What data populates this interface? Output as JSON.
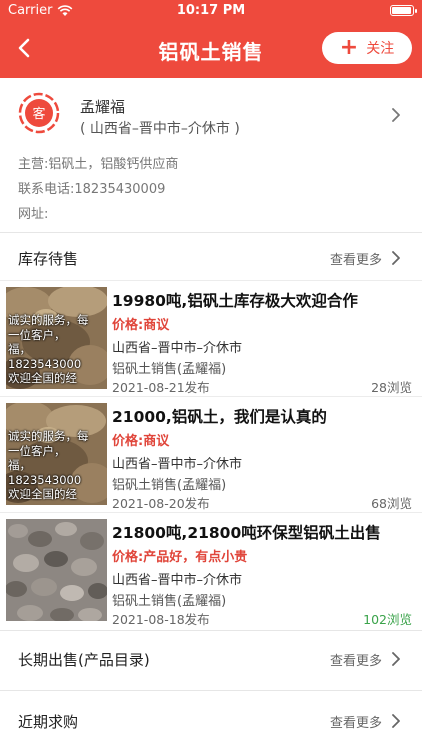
{
  "status_bar": {
    "carrier": "Carrier",
    "time": "10:17 PM",
    "battery_level": 0.95
  },
  "header": {
    "title": "铝矾土销售",
    "follow_label": "关注"
  },
  "profile": {
    "avatar_text": "客",
    "name": "孟耀福",
    "region": "( 山西省–晋中市–介休市 )",
    "business": "主营:铝矾土，铝酸钙供应商",
    "phone": "联系电话:18235430009",
    "website": "网址:"
  },
  "sections": {
    "inventory": {
      "title": "库存待售",
      "more": "查看更多"
    },
    "long_term": {
      "title": "长期出售(产品目录)",
      "more": "查看更多"
    },
    "recent": {
      "title": "近期求购",
      "more": "查看更多"
    }
  },
  "thumb_overlay_lines": [
    "诚实的服务，每",
    "一位客户，",
    "福，",
    "1823543000",
    "欢迎全国的经"
  ],
  "items": [
    {
      "title": "19980吨,铝矾土库存极大欢迎合作",
      "price": "价格:商议",
      "location": "山西省–晋中市–介休市",
      "seller": "铝矾土销售(孟耀福)",
      "date": "2021-08-21发布",
      "views": "28浏览"
    },
    {
      "title": "21000,铝矾土，我们是认真的",
      "price": "价格:商议",
      "location": "山西省–晋中市–介休市",
      "seller": "铝矾土销售(孟耀福)",
      "date": "2021-08-20发布",
      "views": "68浏览"
    },
    {
      "title": "21800吨,21800吨环保型铝矾土出售",
      "price": "价格:产品好，有点小贵",
      "location": "山西省–晋中市–介休市",
      "seller": "铝矾土销售(孟耀福)",
      "date": "2021-08-18发布",
      "views": "102浏览"
    }
  ],
  "colors": {
    "brand": "#ee4a3d",
    "price": "#e0453a",
    "views_highlight": "#3aa34a"
  }
}
